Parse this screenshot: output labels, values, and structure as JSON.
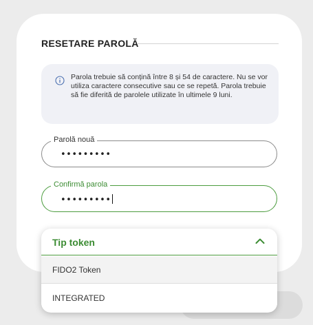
{
  "section": {
    "title": "RESETARE PAROLĂ"
  },
  "info": {
    "icon": "info-icon",
    "text": "Parola trebuie să conțină între 8 și 54 de caractere. Nu se vor utiliza caractere consecutive sau ce se repetă. Parola trebuie să fie diferită de parolele utilizate în ultimele 9 luni."
  },
  "fields": {
    "new_password": {
      "label": "Parolă nouă",
      "value": "•••••••••"
    },
    "confirm_password": {
      "label": "Confirmă parola",
      "value": "•••••••••"
    }
  },
  "token_dropdown": {
    "label": "Tip token",
    "expanded": true,
    "icon": "chevron-up-icon",
    "options": [
      "FIDO2 Token",
      "INTEGRATED"
    ]
  },
  "colors": {
    "accent_green": "#3c8c33",
    "page_bg": "#ececec",
    "card_bg": "#ffffff",
    "info_bg": "#f0f1f6"
  }
}
